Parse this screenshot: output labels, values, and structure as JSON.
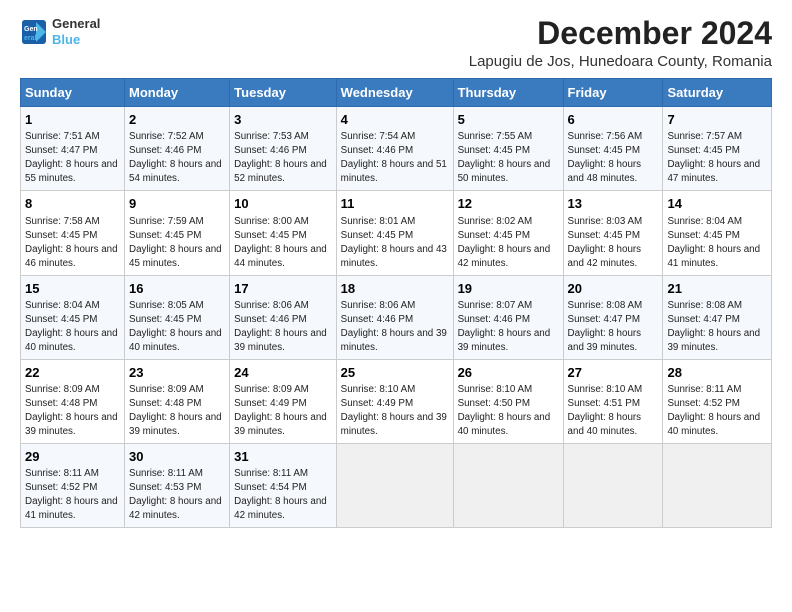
{
  "logo": {
    "line1": "General",
    "line2": "Blue"
  },
  "title": "December 2024",
  "subtitle": "Lapugiu de Jos, Hunedoara County, Romania",
  "headers": [
    "Sunday",
    "Monday",
    "Tuesday",
    "Wednesday",
    "Thursday",
    "Friday",
    "Saturday"
  ],
  "weeks": [
    [
      {
        "day": "1",
        "rise": "Sunrise: 7:51 AM",
        "set": "Sunset: 4:47 PM",
        "daylight": "Daylight: 8 hours and 55 minutes."
      },
      {
        "day": "2",
        "rise": "Sunrise: 7:52 AM",
        "set": "Sunset: 4:46 PM",
        "daylight": "Daylight: 8 hours and 54 minutes."
      },
      {
        "day": "3",
        "rise": "Sunrise: 7:53 AM",
        "set": "Sunset: 4:46 PM",
        "daylight": "Daylight: 8 hours and 52 minutes."
      },
      {
        "day": "4",
        "rise": "Sunrise: 7:54 AM",
        "set": "Sunset: 4:46 PM",
        "daylight": "Daylight: 8 hours and 51 minutes."
      },
      {
        "day": "5",
        "rise": "Sunrise: 7:55 AM",
        "set": "Sunset: 4:45 PM",
        "daylight": "Daylight: 8 hours and 50 minutes."
      },
      {
        "day": "6",
        "rise": "Sunrise: 7:56 AM",
        "set": "Sunset: 4:45 PM",
        "daylight": "Daylight: 8 hours and 48 minutes."
      },
      {
        "day": "7",
        "rise": "Sunrise: 7:57 AM",
        "set": "Sunset: 4:45 PM",
        "daylight": "Daylight: 8 hours and 47 minutes."
      }
    ],
    [
      {
        "day": "8",
        "rise": "Sunrise: 7:58 AM",
        "set": "Sunset: 4:45 PM",
        "daylight": "Daylight: 8 hours and 46 minutes."
      },
      {
        "day": "9",
        "rise": "Sunrise: 7:59 AM",
        "set": "Sunset: 4:45 PM",
        "daylight": "Daylight: 8 hours and 45 minutes."
      },
      {
        "day": "10",
        "rise": "Sunrise: 8:00 AM",
        "set": "Sunset: 4:45 PM",
        "daylight": "Daylight: 8 hours and 44 minutes."
      },
      {
        "day": "11",
        "rise": "Sunrise: 8:01 AM",
        "set": "Sunset: 4:45 PM",
        "daylight": "Daylight: 8 hours and 43 minutes."
      },
      {
        "day": "12",
        "rise": "Sunrise: 8:02 AM",
        "set": "Sunset: 4:45 PM",
        "daylight": "Daylight: 8 hours and 42 minutes."
      },
      {
        "day": "13",
        "rise": "Sunrise: 8:03 AM",
        "set": "Sunset: 4:45 PM",
        "daylight": "Daylight: 8 hours and 42 minutes."
      },
      {
        "day": "14",
        "rise": "Sunrise: 8:04 AM",
        "set": "Sunset: 4:45 PM",
        "daylight": "Daylight: 8 hours and 41 minutes."
      }
    ],
    [
      {
        "day": "15",
        "rise": "Sunrise: 8:04 AM",
        "set": "Sunset: 4:45 PM",
        "daylight": "Daylight: 8 hours and 40 minutes."
      },
      {
        "day": "16",
        "rise": "Sunrise: 8:05 AM",
        "set": "Sunset: 4:45 PM",
        "daylight": "Daylight: 8 hours and 40 minutes."
      },
      {
        "day": "17",
        "rise": "Sunrise: 8:06 AM",
        "set": "Sunset: 4:46 PM",
        "daylight": "Daylight: 8 hours and 39 minutes."
      },
      {
        "day": "18",
        "rise": "Sunrise: 8:06 AM",
        "set": "Sunset: 4:46 PM",
        "daylight": "Daylight: 8 hours and 39 minutes."
      },
      {
        "day": "19",
        "rise": "Sunrise: 8:07 AM",
        "set": "Sunset: 4:46 PM",
        "daylight": "Daylight: 8 hours and 39 minutes."
      },
      {
        "day": "20",
        "rise": "Sunrise: 8:08 AM",
        "set": "Sunset: 4:47 PM",
        "daylight": "Daylight: 8 hours and 39 minutes."
      },
      {
        "day": "21",
        "rise": "Sunrise: 8:08 AM",
        "set": "Sunset: 4:47 PM",
        "daylight": "Daylight: 8 hours and 39 minutes."
      }
    ],
    [
      {
        "day": "22",
        "rise": "Sunrise: 8:09 AM",
        "set": "Sunset: 4:48 PM",
        "daylight": "Daylight: 8 hours and 39 minutes."
      },
      {
        "day": "23",
        "rise": "Sunrise: 8:09 AM",
        "set": "Sunset: 4:48 PM",
        "daylight": "Daylight: 8 hours and 39 minutes."
      },
      {
        "day": "24",
        "rise": "Sunrise: 8:09 AM",
        "set": "Sunset: 4:49 PM",
        "daylight": "Daylight: 8 hours and 39 minutes."
      },
      {
        "day": "25",
        "rise": "Sunrise: 8:10 AM",
        "set": "Sunset: 4:49 PM",
        "daylight": "Daylight: 8 hours and 39 minutes."
      },
      {
        "day": "26",
        "rise": "Sunrise: 8:10 AM",
        "set": "Sunset: 4:50 PM",
        "daylight": "Daylight: 8 hours and 40 minutes."
      },
      {
        "day": "27",
        "rise": "Sunrise: 8:10 AM",
        "set": "Sunset: 4:51 PM",
        "daylight": "Daylight: 8 hours and 40 minutes."
      },
      {
        "day": "28",
        "rise": "Sunrise: 8:11 AM",
        "set": "Sunset: 4:52 PM",
        "daylight": "Daylight: 8 hours and 40 minutes."
      }
    ],
    [
      {
        "day": "29",
        "rise": "Sunrise: 8:11 AM",
        "set": "Sunset: 4:52 PM",
        "daylight": "Daylight: 8 hours and 41 minutes."
      },
      {
        "day": "30",
        "rise": "Sunrise: 8:11 AM",
        "set": "Sunset: 4:53 PM",
        "daylight": "Daylight: 8 hours and 42 minutes."
      },
      {
        "day": "31",
        "rise": "Sunrise: 8:11 AM",
        "set": "Sunset: 4:54 PM",
        "daylight": "Daylight: 8 hours and 42 minutes."
      },
      null,
      null,
      null,
      null
    ]
  ]
}
